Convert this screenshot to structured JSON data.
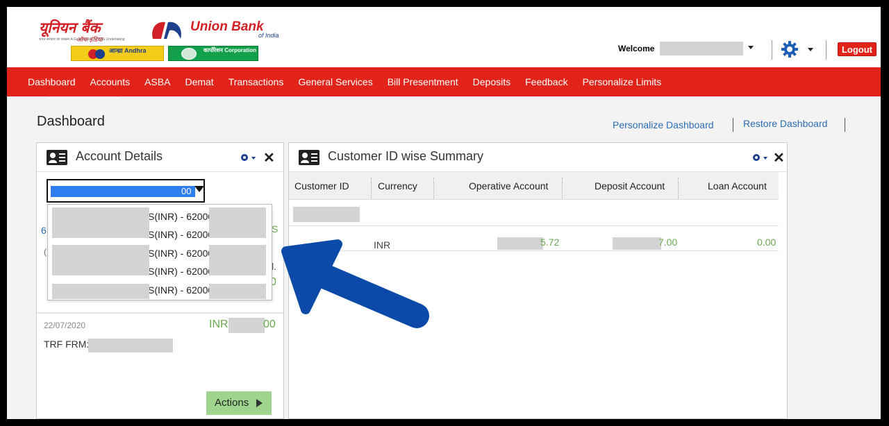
{
  "header": {
    "logo_hindi": "यूनियन बैंक",
    "logo_hindi_sub": "ऑफ इंडिया",
    "logo_tiny": "भारत सरकार का उपक्रम   A Government of India Undertaking",
    "logo_en": "Union Bank",
    "logo_en_sub": "of India",
    "andhra_label": "आन्ध्रा Andhra",
    "corp_label": "कार्पोरेशन Corporation",
    "welcome": "Welcome",
    "logout": "Logout"
  },
  "nav": {
    "items": [
      "Dashboard",
      "Accounts",
      "ASBA",
      "Demat",
      "Transactions",
      "General Services",
      "Bill Presentment",
      "Deposits",
      "Feedback",
      "Personalize Limits"
    ]
  },
  "page": {
    "title": "Dashboard",
    "personalize": "Personalize Dashboard",
    "restore": "Restore Dashboard"
  },
  "account_panel": {
    "title": "Account Details",
    "select_tail": "00",
    "options": [
      "S(INR) - 62000",
      "S(INR) - 62000",
      "S(INR) - 62000",
      "S(INR) - 62000",
      "S(INR) - 62000"
    ],
    "frag_left": "6",
    "frag_left2": "(",
    "frag_right_s": "S",
    "frag_right_dot": "l.",
    "frag_right_0": "0",
    "txn_date": "22/07/2020",
    "txn_amount_prefix": "INR",
    "txn_amount_suffix": "00",
    "txn_desc": "TRF FRM:(",
    "actions": "Actions"
  },
  "summary_panel": {
    "title": "Customer ID wise Summary",
    "columns": [
      "Customer ID",
      "Currency",
      "Operative Account",
      "Deposit Account",
      "Loan Account"
    ],
    "row": {
      "currency": "INR",
      "operative_suffix": "5.72",
      "deposit_suffix": "7.00",
      "loan": "0.00"
    }
  },
  "colors": {
    "brand_red": "#e2231a",
    "link_blue": "#2a6db5",
    "amount_green": "#6aa84f",
    "arrow_blue": "#0b4aa8"
  }
}
